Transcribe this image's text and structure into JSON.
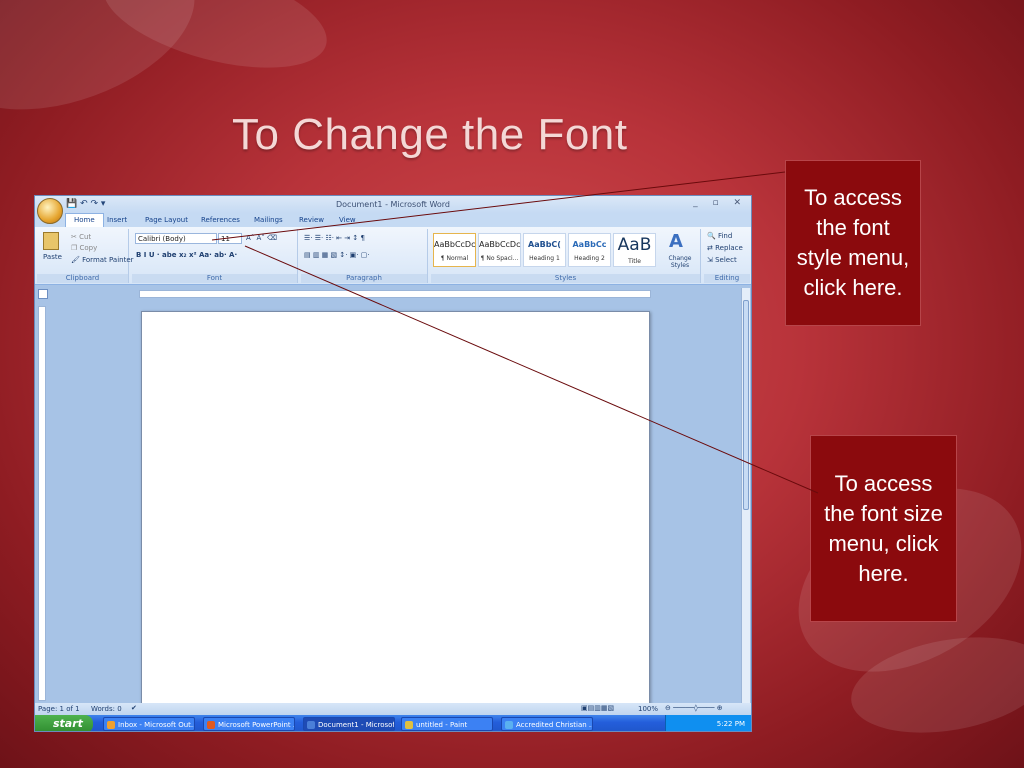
{
  "slide": {
    "title": "To Change the Font",
    "callout_style": "To access the font style menu, click here.",
    "callout_size": "To access the font size menu, click here."
  },
  "word": {
    "window_title": "Document1 - Microsoft Word",
    "tabs": [
      "Home",
      "Insert",
      "Page Layout",
      "References",
      "Mailings",
      "Review",
      "View"
    ],
    "clipboard": {
      "paste": "Paste",
      "cut": "Cut",
      "copy": "Copy",
      "format_painter": "Format Painter",
      "label": "Clipboard"
    },
    "font": {
      "family": "Calibri (Body)",
      "size": "11",
      "label": "Font"
    },
    "paragraph_label": "Paragraph",
    "styles": [
      {
        "sample": "AaBbCcDc",
        "name": "¶ Normal"
      },
      {
        "sample": "AaBbCcDc",
        "name": "¶ No Spaci..."
      },
      {
        "sample": "AaBbC(",
        "name": "Heading 1"
      },
      {
        "sample": "AaBbCc",
        "name": "Heading 2"
      },
      {
        "sample": "AaB",
        "name": "Title"
      }
    ],
    "change_styles": "Change Styles",
    "styles_label": "Styles",
    "editing": {
      "find": "Find",
      "replace": "Replace",
      "select": "Select",
      "label": "Editing"
    },
    "status": {
      "page": "Page: 1 of 1",
      "words": "Words: 0",
      "zoom": "100%"
    }
  },
  "taskbar": {
    "start": "start",
    "items": [
      "Inbox - Microsoft Out...",
      "Microsoft PowerPoint ...",
      "Document1 - Microsof...",
      "untitled - Paint",
      "Accredited Christian ..."
    ],
    "clock": "5:22 PM"
  }
}
